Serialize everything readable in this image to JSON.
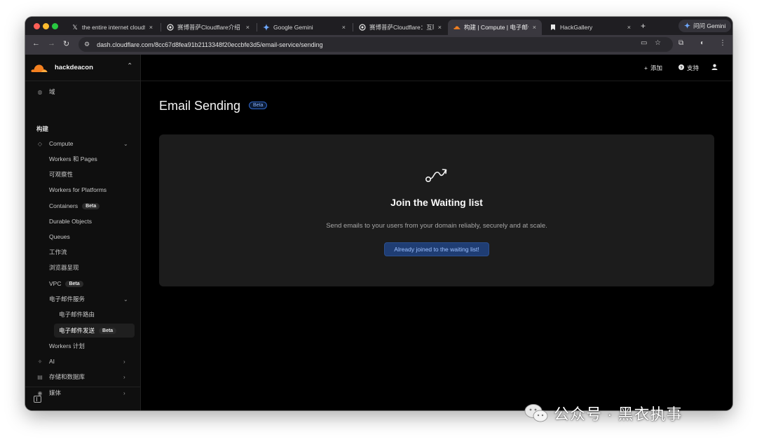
{
  "browser": {
    "tabs": [
      {
        "title": "the entire internet cloudfl",
        "icon": "x-logo-icon"
      },
      {
        "title": "赛博普萨Cloudflare介绍",
        "icon": "openai-icon"
      },
      {
        "title": "Google Gemini",
        "icon": "gemini-icon"
      },
      {
        "title": "赛博普萨Cloudflare：互联",
        "icon": "openai-icon"
      },
      {
        "title": "构建 | Compute | 电子邮件",
        "icon": "cloudflare-icon",
        "active": true
      },
      {
        "title": "HackGallery",
        "icon": "hackgallery-icon"
      }
    ],
    "close_glyph": "×",
    "new_tab_glyph": "+",
    "gemini_button": "问问 Gemini",
    "url": "dash.cloudflare.com/8cc67d8fea91b2113348f20eccbfe3d5/email-service/sending"
  },
  "sidebar": {
    "account_name": "hackdeacon",
    "items": [
      {
        "label": "域"
      },
      {
        "section": "构建"
      },
      {
        "label": "Compute"
      },
      {
        "label": "Workers 和 Pages"
      },
      {
        "label": "可观察性"
      },
      {
        "label": "Workers for Platforms"
      },
      {
        "label": "Containers",
        "badge": "Beta"
      },
      {
        "label": "Durable Objects"
      },
      {
        "label": "Queues"
      },
      {
        "label": "工作流"
      },
      {
        "label": "浏览器呈现"
      },
      {
        "label": "VPC",
        "badge": "Beta"
      },
      {
        "label": "电子邮件服务"
      },
      {
        "label": "电子邮件路由"
      },
      {
        "label": "电子邮件发送",
        "badge": "Beta"
      },
      {
        "label": "Workers 计划"
      },
      {
        "label": "AI"
      },
      {
        "label": "存储和数据库"
      },
      {
        "label": "媒体"
      }
    ]
  },
  "topbar": {
    "add_label": "添加",
    "support_label": "支持"
  },
  "main": {
    "page_title": "Email Sending",
    "title_badge": "Beta",
    "card": {
      "title": "Join the Waiting list",
      "description": "Send emails to your users from your domain reliably, securely and at scale.",
      "button": "Already joined to the waiting list!"
    }
  },
  "watermark": {
    "text": "公众号 · 黑衣执事"
  },
  "colors": {
    "cloudflare_orange": "#f38020",
    "accent_blue": "#1f3d73",
    "background": "#000000"
  }
}
